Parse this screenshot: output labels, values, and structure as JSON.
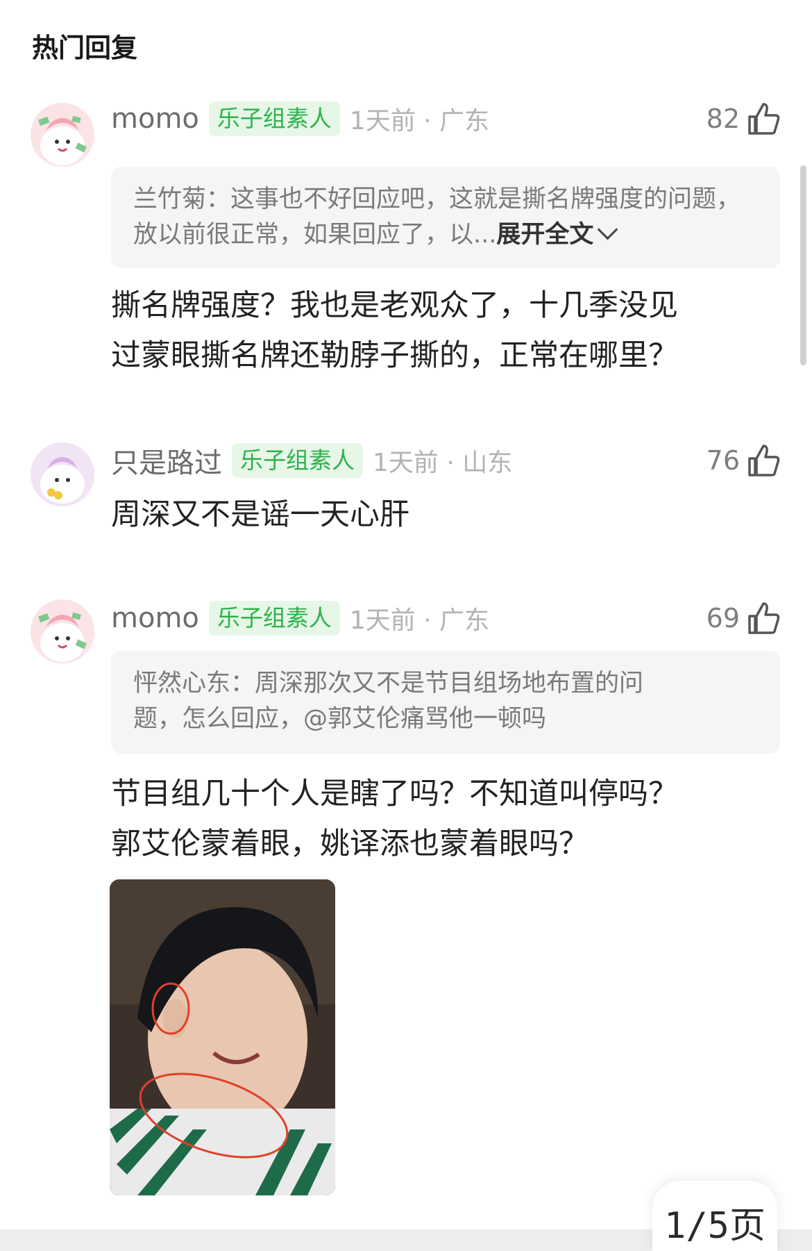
{
  "section_title": "热门回复",
  "comments": [
    {
      "username": "momo",
      "badge": "乐子组素人",
      "meta": "1天前 · 广东",
      "likes": "82",
      "quote_text": "兰竹菊：这事也不好回应吧，这就是撕名牌强度的问题，放以前很正常，如果回应了，以...",
      "expand_label": "展开全文",
      "body_line1": "撕名牌强度？我也是老观众了，十几季没见",
      "body_line2": "过蒙眼撕名牌还勒脖子撕的，正常在哪里？"
    },
    {
      "username": "只是路过",
      "badge": "乐子组素人",
      "meta": "1天前 · 山东",
      "likes": "76",
      "body_line1": "周深又不是谣一天心肝"
    },
    {
      "username": "momo",
      "badge": "乐子组素人",
      "meta": "1天前 · 广东",
      "likes": "69",
      "quote_line1": "怦然心东：周深那次又不是节目组场地布置的问",
      "quote_line2": "题，怎么回应，@郭艾伦痛骂他一顿吗",
      "body_line1": "节目组几十个人是瞎了吗？不知道叫停吗？",
      "body_line2": "郭艾伦蒙着眼，姚译添也蒙着眼吗？"
    }
  ],
  "pager_label": "1/5页",
  "icons": {
    "like": "thumbs-up-icon",
    "avatar": "cartoon-avatar-icon",
    "expand": "chevron-down-icon"
  },
  "colors": {
    "badge_text": "#2fb24a",
    "badge_bg": "#e6f7e8",
    "annotation_circle": "#e0402a"
  }
}
